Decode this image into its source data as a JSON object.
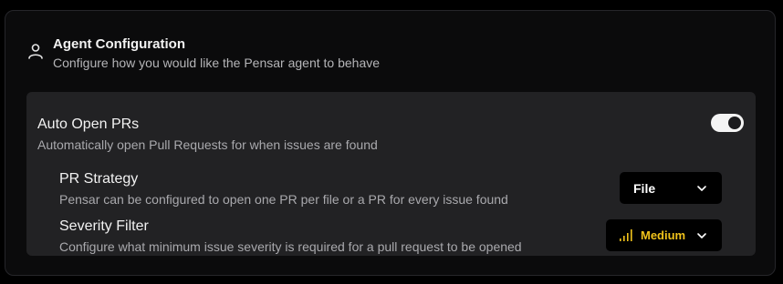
{
  "header": {
    "title": "Agent Configuration",
    "subtitle": "Configure how you would like the Pensar agent to behave",
    "icon": "user-icon"
  },
  "auto_open_prs": {
    "title": "Auto Open PRs",
    "description": "Automatically open Pull Requests for when issues are found",
    "enabled": true
  },
  "pr_strategy": {
    "title": "PR Strategy",
    "description": "Pensar can be configured to open one PR per file or a PR for every issue found",
    "selected": "File"
  },
  "severity_filter": {
    "title": "Severity Filter",
    "description": "Configure what minimum issue severity is required for a pull request to be opened",
    "selected": "Medium",
    "icon": "severity-bars-icon"
  },
  "colors": {
    "background": "#000000",
    "card": "#0b0b0c",
    "panel": "#222224",
    "accent_medium": "#f0c21b",
    "toggle_on": "#f4f4f4"
  }
}
